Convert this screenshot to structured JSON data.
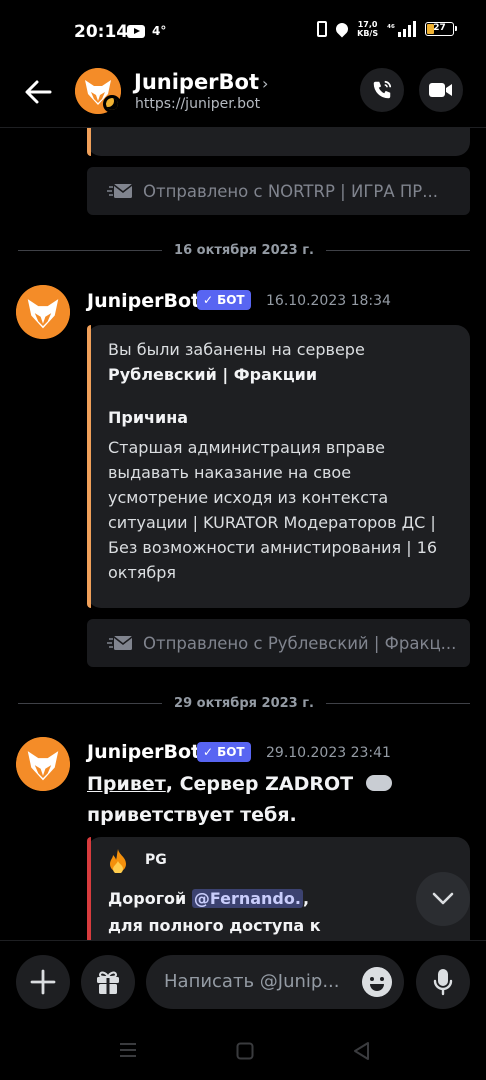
{
  "status_bar": {
    "time": "20:14",
    "temperature": "4°",
    "net_speed_value": "17,0",
    "net_speed_unit": "KB/S",
    "network": "⁴⁶",
    "battery": "27"
  },
  "header": {
    "name": "JuniperBot",
    "url": "https://juniper.bot"
  },
  "messages": {
    "prev_footer": "Отправлено с NORTRP | ИГРА ПР...",
    "divider1": "16 октября 2023 г.",
    "msg1": {
      "author": "JuniperBot",
      "bot_tag": "БОТ",
      "timestamp": "16.10.2023 18:34",
      "embed_line1": "Вы были забанены на сервере",
      "embed_server": "Рублевский | Фракции",
      "reason_title": "Причина",
      "reason_text": "Старшая администрация вправе выдавать наказание на свое усмотрение исходя из контекста ситуации | KURATOR Модераторов ДС | Без возможности амнистирования | 16 октября",
      "footer": "Отправлено с Рублевский | Фракц..."
    },
    "divider2": "29 октября 2023 г.",
    "msg2": {
      "author": "JuniperBot",
      "bot_tag": "БОТ",
      "timestamp": "29.10.2023 23:41",
      "greeting_link": "Привет",
      "greeting_rest": ", Сервер ZADROT",
      "greeting_line2": "приветствует тебя.",
      "embed_author": "PG",
      "embed_line1_pre": "Дорогой ",
      "embed_mention": "@Fernando.",
      "embed_line1_post": ",",
      "embed_line2": "для полного доступа к"
    }
  },
  "input": {
    "placeholder": "Написать @Junip..."
  },
  "colors": {
    "accent_orange": "#f0a05a",
    "accent_red": "#d83c3e",
    "bot_badge": "#5865f2"
  }
}
